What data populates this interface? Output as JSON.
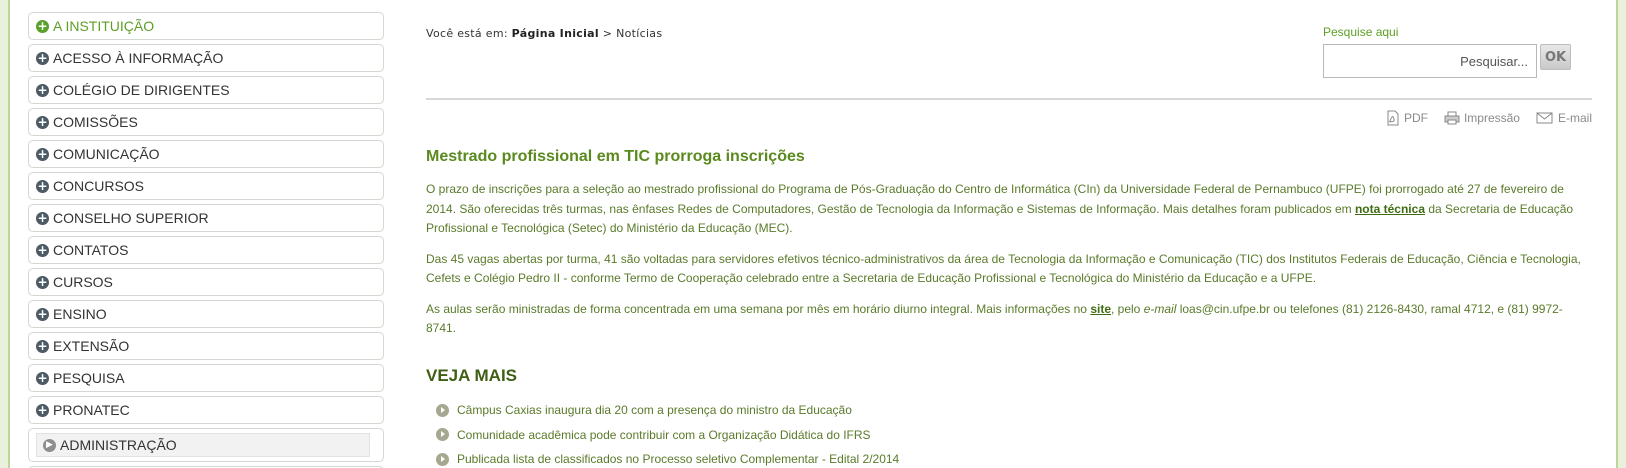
{
  "sidebar": {
    "items": [
      {
        "label": "A INSTITUIÇÃO",
        "icon": "plus-circle-icon"
      },
      {
        "label": "ACESSO À INFORMAÇÃO",
        "icon": "plus-circle-icon"
      },
      {
        "label": "COLÉGIO DE DIRIGENTES",
        "icon": "plus-circle-icon"
      },
      {
        "label": "COMISSÕES",
        "icon": "plus-circle-icon"
      },
      {
        "label": "COMUNICAÇÃO",
        "icon": "plus-circle-icon"
      },
      {
        "label": "CONCURSOS",
        "icon": "plus-circle-icon"
      },
      {
        "label": "CONSELHO SUPERIOR",
        "icon": "plus-circle-icon"
      },
      {
        "label": "CONTATOS",
        "icon": "plus-circle-icon"
      },
      {
        "label": "CURSOS",
        "icon": "plus-circle-icon"
      },
      {
        "label": "ENSINO",
        "icon": "plus-circle-icon"
      },
      {
        "label": "EXTENSÃO",
        "icon": "plus-circle-icon"
      },
      {
        "label": "PESQUISA",
        "icon": "plus-circle-icon"
      },
      {
        "label": "PRONATEC",
        "icon": "plus-circle-icon"
      },
      {
        "label": "ADMINISTRAÇÃO",
        "icon": "arrow-circle-icon"
      }
    ],
    "active_color": "#5e9e25"
  },
  "breadcrumb": {
    "prefix": "Você está em:",
    "home": "Página Inicial",
    "separator": ">",
    "current": "Notícias"
  },
  "search": {
    "label": "Pesquise aqui",
    "placeholder": "Pesquisar...",
    "button": "OK"
  },
  "tools": {
    "pdf": "PDF",
    "print": "Impressão",
    "email": "E-mail"
  },
  "article": {
    "title": "Mestrado profissional em TIC prorroga inscrições",
    "p1_a": "O prazo de inscrições para a seleção ao mestrado profissional do Programa de Pós-Graduação do Centro de Informática (CIn) da Universidade Federal de Pernambuco (UFPE) foi prorrogado até 27 de fevereiro de 2014. São oferecidas três turmas, nas ênfases Redes de Computadores, Gestão de Tecnologia da Informação e Sistemas de Informação. Mais detalhes foram publicados em ",
    "p1_link": "nota técnica",
    "p1_b": " da Secretaria de Educação Profissional e Tecnológica (Setec) do Ministério da Educação (MEC).",
    "p2": "Das 45 vagas abertas por turma, 41 são voltadas para servidores efetivos técnico-administrativos da área de Tecnologia da Informação e Comunicação (TIC) dos Institutos Federais de Educação, Ciência e Tecnologia, Cefets e Colégio Pedro II - conforme Termo de Cooperação celebrado entre a Secretaria de Educação Profissional e Tecnológica do Ministério da Educação e a UFPE.",
    "p3_a": "As aulas serão ministradas de forma concentrada em uma semana por mês em horário diurno integral. Mais informações no ",
    "p3_link": "site",
    "p3_b": ", pelo ",
    "p3_em": "e-mail",
    "p3_c": " loas@cin.ufpe.br ou telefones (81) 2126-8430, ramal 4712, e (81) 9972-8741."
  },
  "veja_mais": {
    "title": "VEJA MAIS",
    "items": [
      "Câmpus Caxias inaugura dia 20 com a presença do ministro da Educação",
      "Comunidade acadêmica pode contribuir com a Organização Didática do IFRS",
      "Publicada lista de classificados no Processo seletivo Complementar - Edital 2/2014"
    ]
  }
}
